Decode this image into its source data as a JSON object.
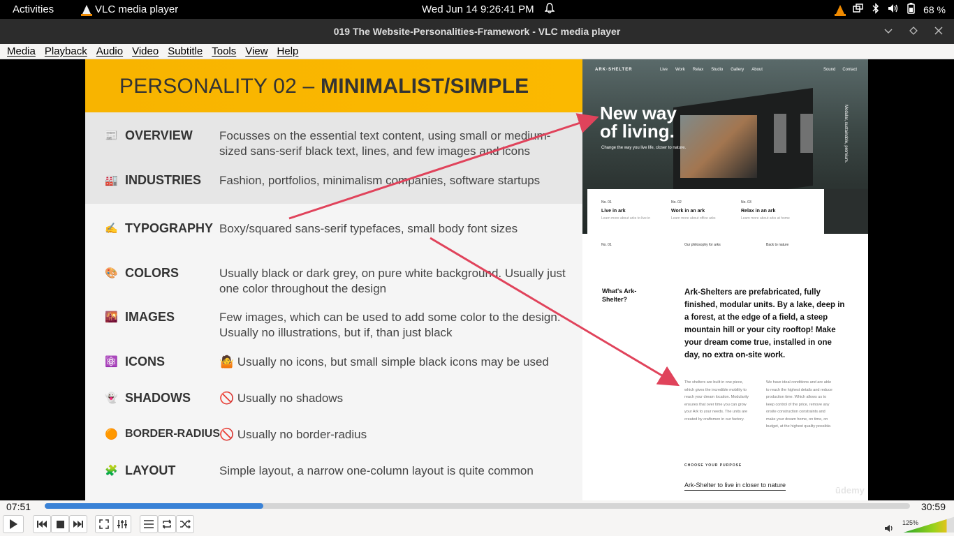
{
  "topbar": {
    "activities": "Activities",
    "app_name": "VLC media player",
    "datetime": "Wed Jun 14   9:26:41 PM",
    "battery": "68 %"
  },
  "window": {
    "title": "019 The Website-Personalities-Framework - VLC media player"
  },
  "menu": [
    "Media",
    "Playback",
    "Audio",
    "Video",
    "Subtitle",
    "Tools",
    "View",
    "Help"
  ],
  "slide": {
    "title_prefix": "PERSONALITY 02 –",
    "title_bold": "MINIMALIST/SIMPLE",
    "rows": [
      {
        "icon": "📰",
        "label": "OVERVIEW",
        "desc": "Focusses on the essential text content, using small or medium-sized sans-serif black text, lines, and few images and icons"
      },
      {
        "icon": "🏭",
        "label": "INDUSTRIES",
        "desc": "Fashion, portfolios, minimalism companies, software startups"
      },
      {
        "icon": "✍️",
        "label": "TYPOGRAPHY",
        "desc": "Boxy/squared sans-serif typefaces, small body font sizes"
      },
      {
        "icon": "🎨",
        "label": "COLORS",
        "desc": "Usually black or dark grey, on pure white background. Usually just one color throughout the design"
      },
      {
        "icon": "🌇",
        "label": "IMAGES",
        "desc": "Few images, which can be used to add some color to the design. Usually no illustrations, but if, than just black"
      },
      {
        "icon": "⚛️",
        "label": "ICONS",
        "desc": "🤷 Usually no icons, but small simple black icons may be used"
      },
      {
        "icon": "👻",
        "label": "SHADOWS",
        "desc": "🚫 Usually no shadows"
      },
      {
        "icon": "🟠",
        "label": "BORDER-RADIUS",
        "desc": "🚫 Usually no border-radius"
      },
      {
        "icon": "🧩",
        "label": "LAYOUT",
        "desc": "Simple layout, a narrow one-column layout is quite common"
      }
    ]
  },
  "site": {
    "brand": "ARK·SHELTER",
    "nav_links": [
      "Live",
      "Work",
      "Relax",
      "Studio",
      "Gallery",
      "About"
    ],
    "nav_right": [
      "Sound",
      "Contact"
    ],
    "headline_1": "New way",
    "headline_2": "of living.",
    "tagline": "Change the way you live life, closer to nature.",
    "vertical": "Modular, sustainable, premium.",
    "cards": [
      {
        "num": "No. 01",
        "title": "Live in ark",
        "sub": "Learn more about arks to live in"
      },
      {
        "num": "No. 02",
        "title": "Work in an ark",
        "sub": "Learn more about office arks"
      },
      {
        "num": "No. 03",
        "title": "Relax in an ark",
        "sub": "Learn more about arks at home"
      }
    ],
    "small_labels": [
      "No. 01",
      "Our philosophy for arks",
      "Back to nature"
    ],
    "what_is": "What's Ark-Shelter?",
    "paragraph": "Ark-Shelters are prefabricated, fully finished, modular units. By a lake, deep in a forest, at the edge of a field, a steep mountain hill or your city rooftop! Make your dream come true, installed in one day, no extra on-site work.",
    "col_1": "The shelters are built in one piece, which gives the incredible mobility to reach your dream location. Modularity ensures that over time you can grow your Ark to your needs. The units are created by craftsmen in our factory.",
    "col_2": "We have ideal conditions and are able to reach the highest details and reduce production time. Which allows us to keep control of the price, remove any onsite construction constraints and make your dream home, on time, on budget, at the highest quality possible.",
    "choose": "CHOOSE YOUR PURPOSE",
    "cta": "Ark-Shelter to live in closer to nature",
    "watermark": "ūdemy"
  },
  "player": {
    "current_time": "07:51",
    "total_time": "30:59",
    "progress": 0.253,
    "volume_label": "125%",
    "accent": "#3a82d6"
  }
}
